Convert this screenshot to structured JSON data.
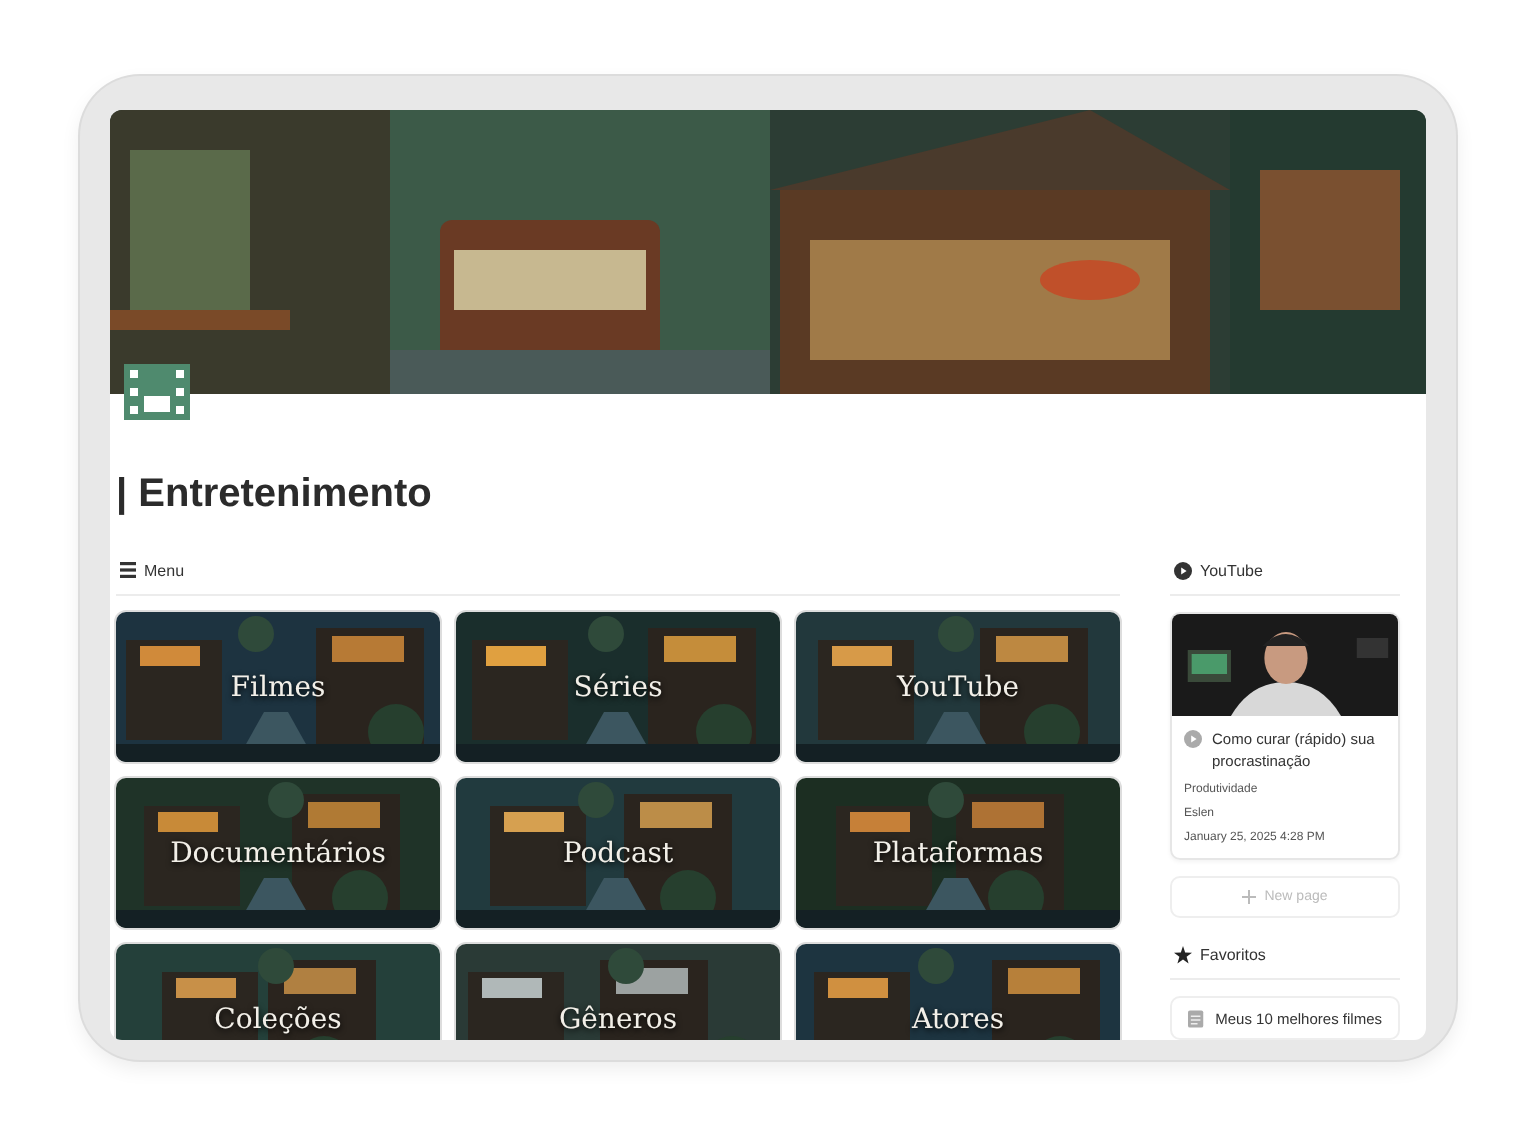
{
  "page": {
    "title": "| Entretenimento"
  },
  "menu": {
    "label": "Menu",
    "tiles": [
      {
        "label": "Filmes"
      },
      {
        "label": "Séries"
      },
      {
        "label": "YouTube"
      },
      {
        "label": "Documentários"
      },
      {
        "label": "Podcast"
      },
      {
        "label": "Plataformas"
      },
      {
        "label": "Coleções"
      },
      {
        "label": "Gêneros"
      },
      {
        "label": "Atores"
      }
    ]
  },
  "youtube": {
    "label": "YouTube",
    "cards": [
      {
        "title": "Como curar (rápido) sua procrastinação",
        "category": "Produtividade",
        "author": "Eslen",
        "date": "January 25, 2025 4:28 PM"
      }
    ],
    "new_page": "New page"
  },
  "favorites": {
    "label": "Favoritos",
    "items": [
      {
        "title": "Meus 10 melhores filmes"
      }
    ]
  }
}
